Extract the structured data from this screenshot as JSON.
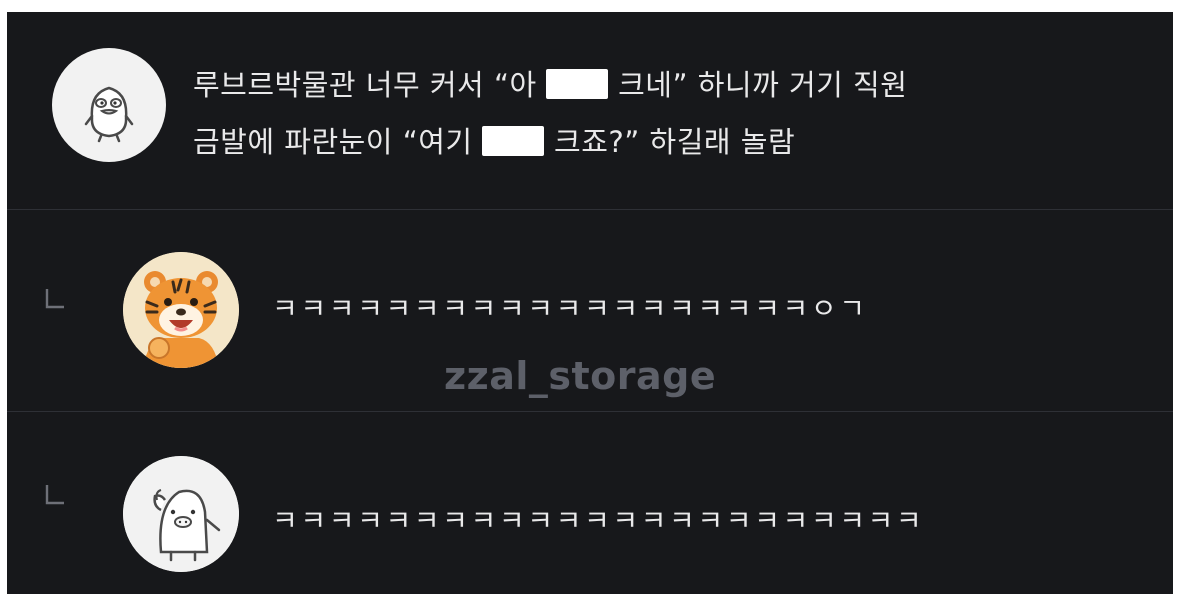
{
  "comments": [
    {
      "avatar_icon": "penguin-avatar-icon",
      "line1_a": "루브르박물관 너무 커서 “아 ",
      "line1_b": " 크네” 하니까 거기 직원",
      "line2_a": "금발에 파란눈이 “여기 ",
      "line2_b": " 크죠?” 하길래 놀람"
    },
    {
      "avatar_icon": "tiger-avatar-icon",
      "reply_icon": "reply-arrow-icon",
      "text": "ㅋㅋㅋㅋㅋㅋㅋㅋㅋㅋㅋㅋㅋㅋㅋㅋㅋㅋㅋㅇㄱ"
    },
    {
      "avatar_icon": "pig-avatar-icon",
      "reply_icon": "reply-arrow-icon",
      "text": "ㅋㅋㅋㅋㅋㅋㅋㅋㅋㅋㅋㅋㅋㅋㅋㅋㅋㅋㅋㅋㅋㅋㅋ"
    }
  ],
  "watermark": "zzal_storage",
  "colors": {
    "background": "#17181b",
    "divider": "#2e3036",
    "text": "#e9e9ea",
    "watermark": "#5d6069",
    "censor": "#ffffff"
  }
}
